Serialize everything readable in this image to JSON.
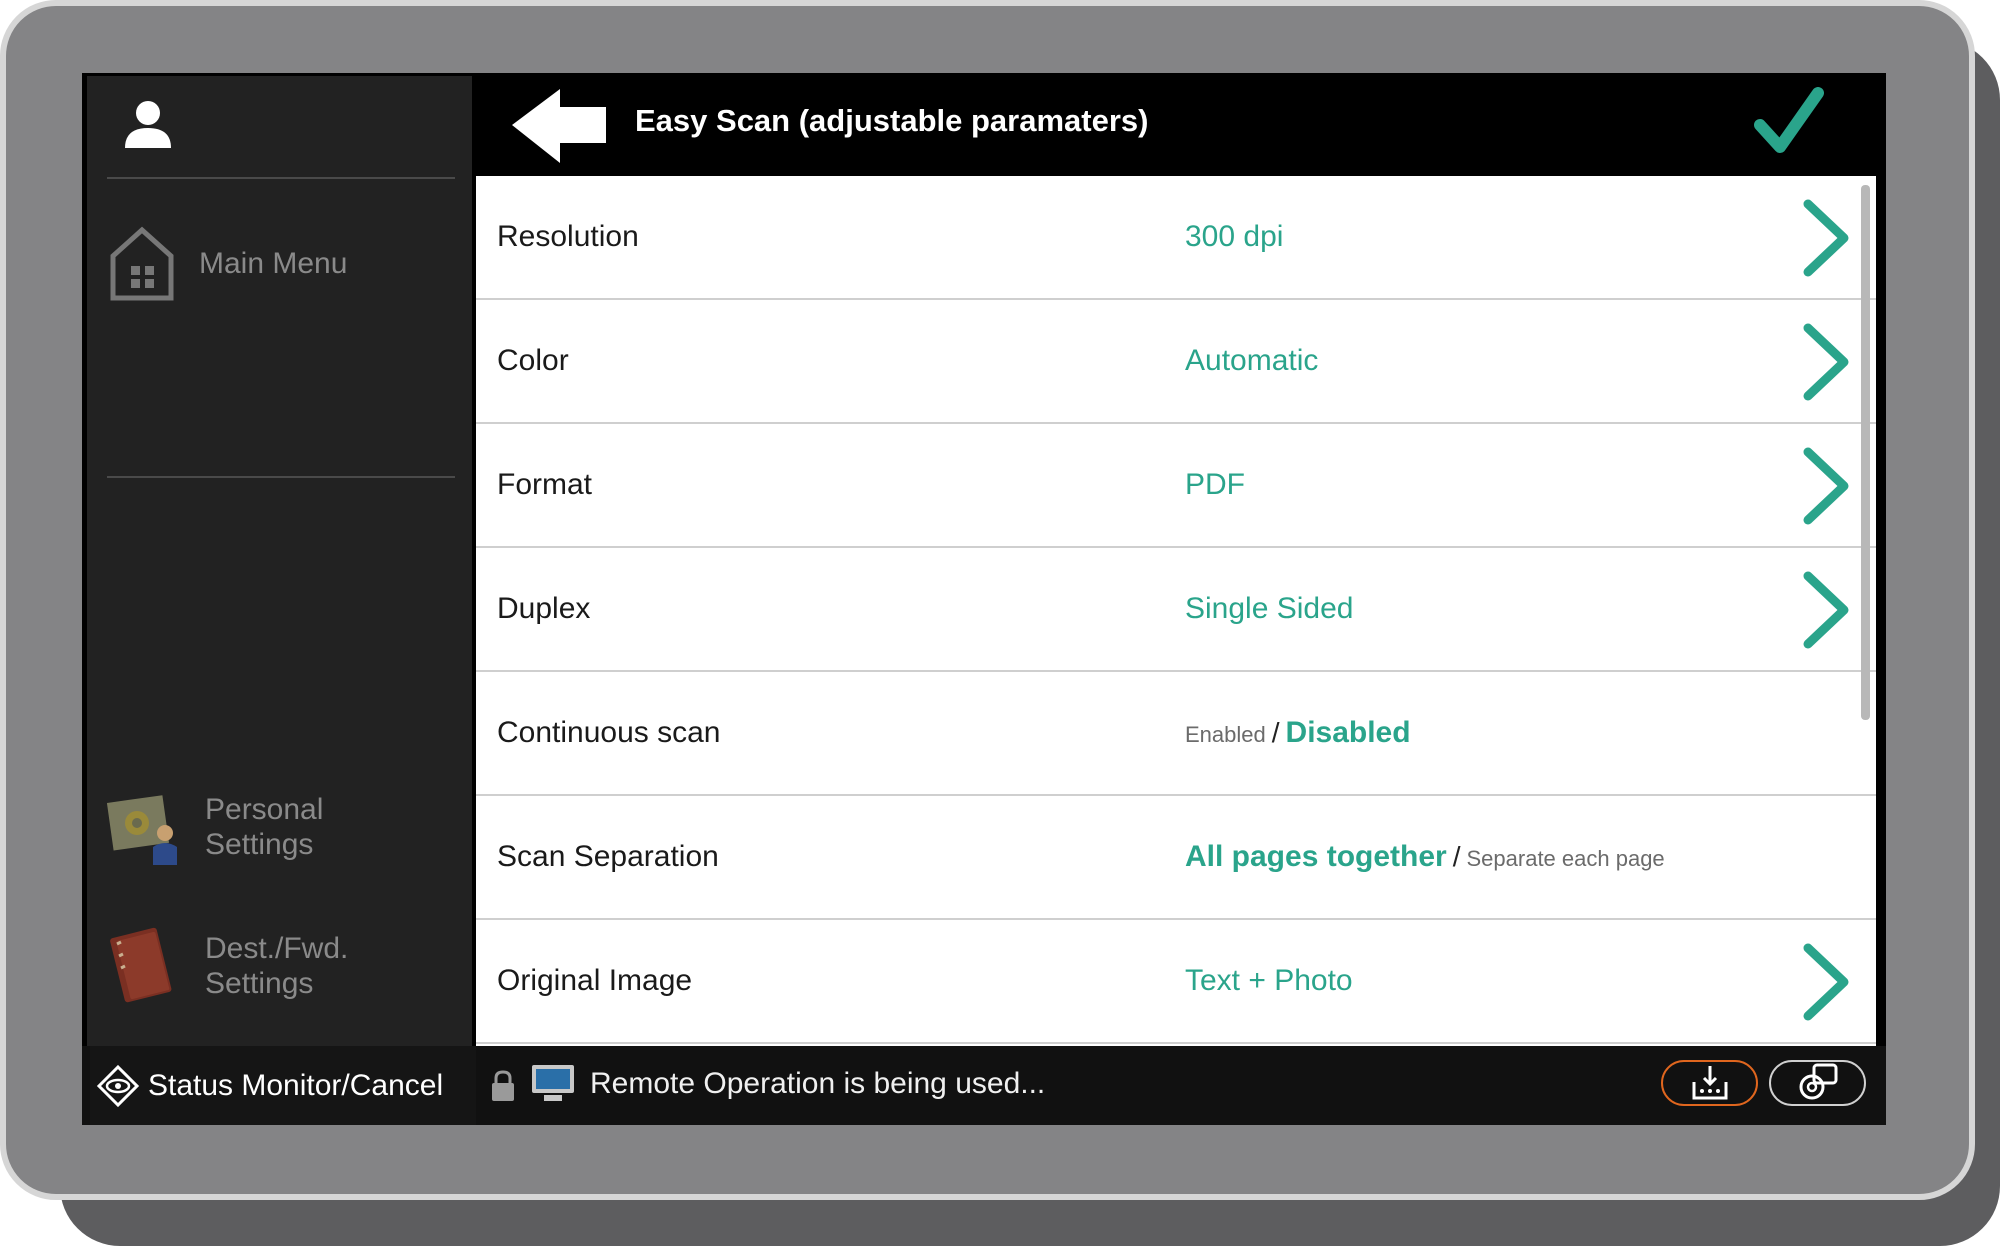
{
  "header": {
    "title": "Easy Scan (adjustable paramaters)",
    "back_icon": "back-arrow-icon",
    "confirm_icon": "checkmark-icon"
  },
  "sidebar": {
    "user_icon": "user-icon",
    "main_menu": {
      "label": "Main Menu",
      "icon": "home-icon"
    },
    "personal_settings": {
      "label_line1": "Personal",
      "label_line2": "Settings",
      "icon": "personal-settings-icon"
    },
    "dest_settings": {
      "label_line1": "Dest./Fwd.",
      "label_line2": "Settings",
      "icon": "address-book-icon"
    }
  },
  "settings": [
    {
      "label": "Resolution",
      "value": "300 dpi"
    },
    {
      "label": "Color",
      "value": "Automatic"
    },
    {
      "label": "Format",
      "value": "PDF"
    },
    {
      "label": "Duplex",
      "value": "Single Sided"
    },
    {
      "label": "Continuous scan",
      "option_a": "Enabled",
      "option_b": "Disabled",
      "selected": "Disabled"
    },
    {
      "label": "Scan Separation",
      "option_a": "All pages together",
      "option_b": "Separate each page",
      "selected": "All pages together"
    },
    {
      "label": "Original Image",
      "value": "Text + Photo"
    }
  ],
  "status_bar": {
    "status_monitor_label": "Status Monitor/Cancel",
    "status_monitor_icon": "status-monitor-icon",
    "lock_icon": "lock-icon",
    "remote_icon": "remote-monitor-icon",
    "message": "Remote Operation is being used...",
    "pill_left_icon": "job-status-icon",
    "pill_right_icon": "settings-switch-icon"
  },
  "colors": {
    "accent": "#2aa48b",
    "topbar": "#000000",
    "sidebar": "#222222",
    "pill_orange": "#e0661e"
  }
}
